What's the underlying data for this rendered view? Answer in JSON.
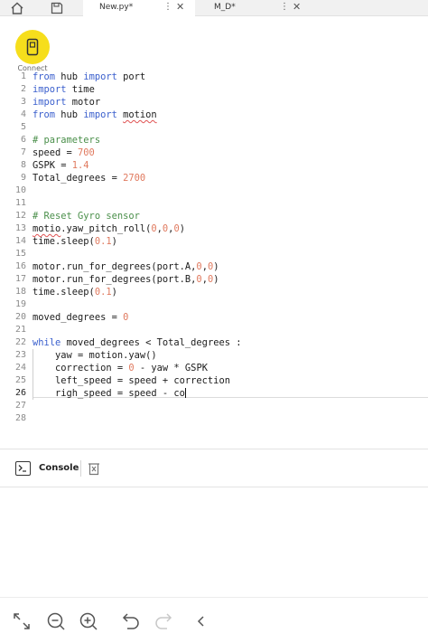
{
  "tabs": [
    {
      "label": "New.py*",
      "active": true
    },
    {
      "label": "M_D*",
      "active": false
    }
  ],
  "connect": {
    "label": "Connect"
  },
  "editor": {
    "lines": [
      {
        "n": "1",
        "segs": [
          {
            "t": "from ",
            "c": "kw"
          },
          {
            "t": "hub ",
            "c": ""
          },
          {
            "t": "import ",
            "c": "kw"
          },
          {
            "t": "port",
            "c": ""
          }
        ]
      },
      {
        "n": "2",
        "segs": [
          {
            "t": "import ",
            "c": "kw"
          },
          {
            "t": "time",
            "c": ""
          }
        ]
      },
      {
        "n": "3",
        "segs": [
          {
            "t": "import ",
            "c": "kw"
          },
          {
            "t": "motor",
            "c": ""
          }
        ]
      },
      {
        "n": "4",
        "segs": [
          {
            "t": "from ",
            "c": "kw"
          },
          {
            "t": "hub ",
            "c": ""
          },
          {
            "t": "import ",
            "c": "kw"
          },
          {
            "t": "motion",
            "c": "squig"
          }
        ]
      },
      {
        "n": "5",
        "segs": []
      },
      {
        "n": "6",
        "segs": [
          {
            "t": "# parameters",
            "c": "cm"
          }
        ]
      },
      {
        "n": "7",
        "segs": [
          {
            "t": "speed = ",
            "c": ""
          },
          {
            "t": "700",
            "c": "num"
          }
        ]
      },
      {
        "n": "8",
        "segs": [
          {
            "t": "GSPK = ",
            "c": ""
          },
          {
            "t": "1.4",
            "c": "num"
          }
        ]
      },
      {
        "n": "9",
        "segs": [
          {
            "t": "Total_degrees = ",
            "c": ""
          },
          {
            "t": "2700",
            "c": "num"
          }
        ]
      },
      {
        "n": "10",
        "segs": []
      },
      {
        "n": "11",
        "segs": []
      },
      {
        "n": "12",
        "segs": [
          {
            "t": "# Reset Gyro sensor",
            "c": "cm"
          }
        ]
      },
      {
        "n": "13",
        "segs": [
          {
            "t": "motio",
            "c": "squig"
          },
          {
            "t": ".yaw_pitch_roll(",
            "c": ""
          },
          {
            "t": "0",
            "c": "num"
          },
          {
            "t": ",",
            "c": ""
          },
          {
            "t": "0",
            "c": "num"
          },
          {
            "t": ",",
            "c": ""
          },
          {
            "t": "0",
            "c": "num"
          },
          {
            "t": ")",
            "c": ""
          }
        ]
      },
      {
        "n": "14",
        "segs": [
          {
            "t": "time.sleep(",
            "c": ""
          },
          {
            "t": "0.1",
            "c": "num"
          },
          {
            "t": ")",
            "c": ""
          }
        ]
      },
      {
        "n": "15",
        "segs": []
      },
      {
        "n": "16",
        "segs": [
          {
            "t": "motor.run_for_degrees(port.A,",
            "c": ""
          },
          {
            "t": "0",
            "c": "num"
          },
          {
            "t": ",",
            "c": ""
          },
          {
            "t": "0",
            "c": "num"
          },
          {
            "t": ")",
            "c": ""
          }
        ]
      },
      {
        "n": "17",
        "segs": [
          {
            "t": "motor.run_for_degrees(port.B,",
            "c": ""
          },
          {
            "t": "0",
            "c": "num"
          },
          {
            "t": ",",
            "c": ""
          },
          {
            "t": "0",
            "c": "num"
          },
          {
            "t": ")",
            "c": ""
          }
        ]
      },
      {
        "n": "18",
        "segs": [
          {
            "t": "time.sleep(",
            "c": ""
          },
          {
            "t": "0.1",
            "c": "num"
          },
          {
            "t": ")",
            "c": ""
          }
        ]
      },
      {
        "n": "19",
        "segs": []
      },
      {
        "n": "20",
        "segs": [
          {
            "t": "moved_degrees = ",
            "c": ""
          },
          {
            "t": "0",
            "c": "num"
          }
        ]
      },
      {
        "n": "21",
        "segs": []
      },
      {
        "n": "22",
        "segs": [
          {
            "t": "while ",
            "c": "kw"
          },
          {
            "t": "moved_degrees < Total_degrees :",
            "c": ""
          }
        ]
      },
      {
        "n": "23",
        "segs": [
          {
            "t": "    yaw = motion.yaw()",
            "c": ""
          }
        ]
      },
      {
        "n": "24",
        "segs": [
          {
            "t": "    correction = ",
            "c": ""
          },
          {
            "t": "0",
            "c": "num"
          },
          {
            "t": " - yaw * GSPK",
            "c": ""
          }
        ]
      },
      {
        "n": "25",
        "segs": [
          {
            "t": "    left_speed = speed + correction",
            "c": ""
          }
        ]
      },
      {
        "n": "26",
        "segs": [
          {
            "t": "    righ_speed = speed - co",
            "c": ""
          }
        ]
      },
      {
        "n": "27",
        "segs": []
      },
      {
        "n": "28",
        "segs": []
      }
    ]
  },
  "console": {
    "label": "Console"
  }
}
